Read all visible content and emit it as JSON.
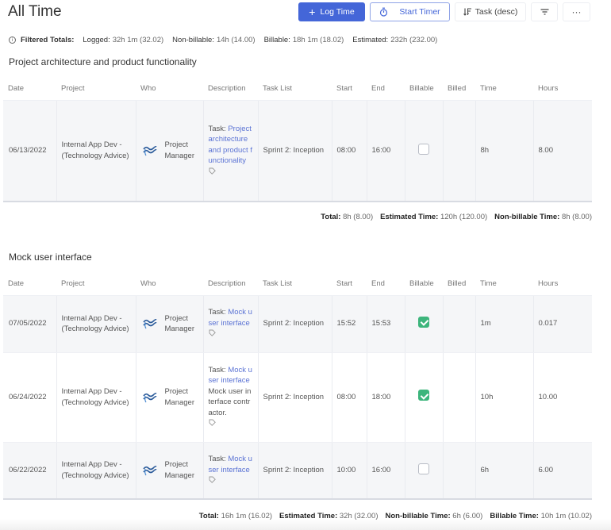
{
  "header": {
    "title": "All Time"
  },
  "toolbar": {
    "log_time": "Log Time",
    "start_timer": "Start Timer",
    "sort": "Task (desc)",
    "more": "···",
    "icons": {
      "log_time": "plus-icon",
      "start_timer": "stopwatch-icon",
      "sort": "sort-icon",
      "filter": "filter-icon",
      "more": "more-icon"
    }
  },
  "filtered_totals": {
    "label": "Filtered Totals:",
    "items": [
      {
        "label": "Logged:",
        "value": "32h 1m (32.02)"
      },
      {
        "label": "Non-billable:",
        "value": "14h (14.00)"
      },
      {
        "label": "Billable:",
        "value": "18h 1m (18.02)"
      },
      {
        "label": "Estimated:",
        "value": "232h (232.00)"
      }
    ]
  },
  "columns": [
    "Date",
    "Project",
    "Who",
    "Description",
    "Task List",
    "Start",
    "End",
    "Billable",
    "Billed",
    "Time",
    "Hours"
  ],
  "groups": [
    {
      "title": "Project architecture and product functionality",
      "rows": [
        {
          "date": "06/13/2022",
          "project": "Internal App Dev - (Technology Advice)",
          "who": "Project Manager",
          "desc_prefix": "Task:",
          "desc_link": "Project architecture and product functionality",
          "desc_note": "",
          "task_list": "Sprint 2: Inception",
          "start": "08:00",
          "end": "16:00",
          "billable": false,
          "billed": "",
          "time": "8h",
          "hours": "8.00"
        }
      ],
      "totals": [
        {
          "label": "Total:",
          "value": "8h (8.00)"
        },
        {
          "label": "Estimated Time:",
          "value": "120h (120.00)"
        },
        {
          "label": "Non-billable Time:",
          "value": "8h (8.00)"
        }
      ]
    },
    {
      "title": "Mock user interface",
      "rows": [
        {
          "date": "07/05/2022",
          "project": "Internal App Dev - (Technology Advice)",
          "who": "Project Manager",
          "desc_prefix": "Task:",
          "desc_link": "Mock user interface",
          "desc_note": "",
          "task_list": "Sprint 2: Inception",
          "start": "15:52",
          "end": "15:53",
          "billable": true,
          "billed": "",
          "time": "1m",
          "hours": "0.017"
        },
        {
          "date": "06/24/2022",
          "project": "Internal App Dev - (Technology Advice)",
          "who": "Project Manager",
          "desc_prefix": "Task:",
          "desc_link": "Mock user interface",
          "desc_note": "Mock user interface contractor.",
          "task_list": "Sprint 2: Inception",
          "start": "08:00",
          "end": "18:00",
          "billable": true,
          "billed": "",
          "time": "10h",
          "hours": "10.00"
        },
        {
          "date": "06/22/2022",
          "project": "Internal App Dev - (Technology Advice)",
          "who": "Project Manager",
          "desc_prefix": "Task:",
          "desc_link": "Mock user interface",
          "desc_note": "",
          "task_list": "Sprint 2: Inception",
          "start": "10:00",
          "end": "16:00",
          "billable": false,
          "billed": "",
          "time": "6h",
          "hours": "6.00"
        }
      ],
      "totals": [
        {
          "label": "Total:",
          "value": "16h 1m (16.02)"
        },
        {
          "label": "Estimated Time:",
          "value": "32h (32.00)"
        },
        {
          "label": "Non-billable Time:",
          "value": "6h (6.00)"
        },
        {
          "label": "Billable Time:",
          "value": "10h 1m (10.02)"
        }
      ]
    }
  ],
  "colors": {
    "primary": "#4466d8",
    "link": "#5b73d4",
    "checked": "#3db57c",
    "row_shade": "#f5f6f8"
  }
}
